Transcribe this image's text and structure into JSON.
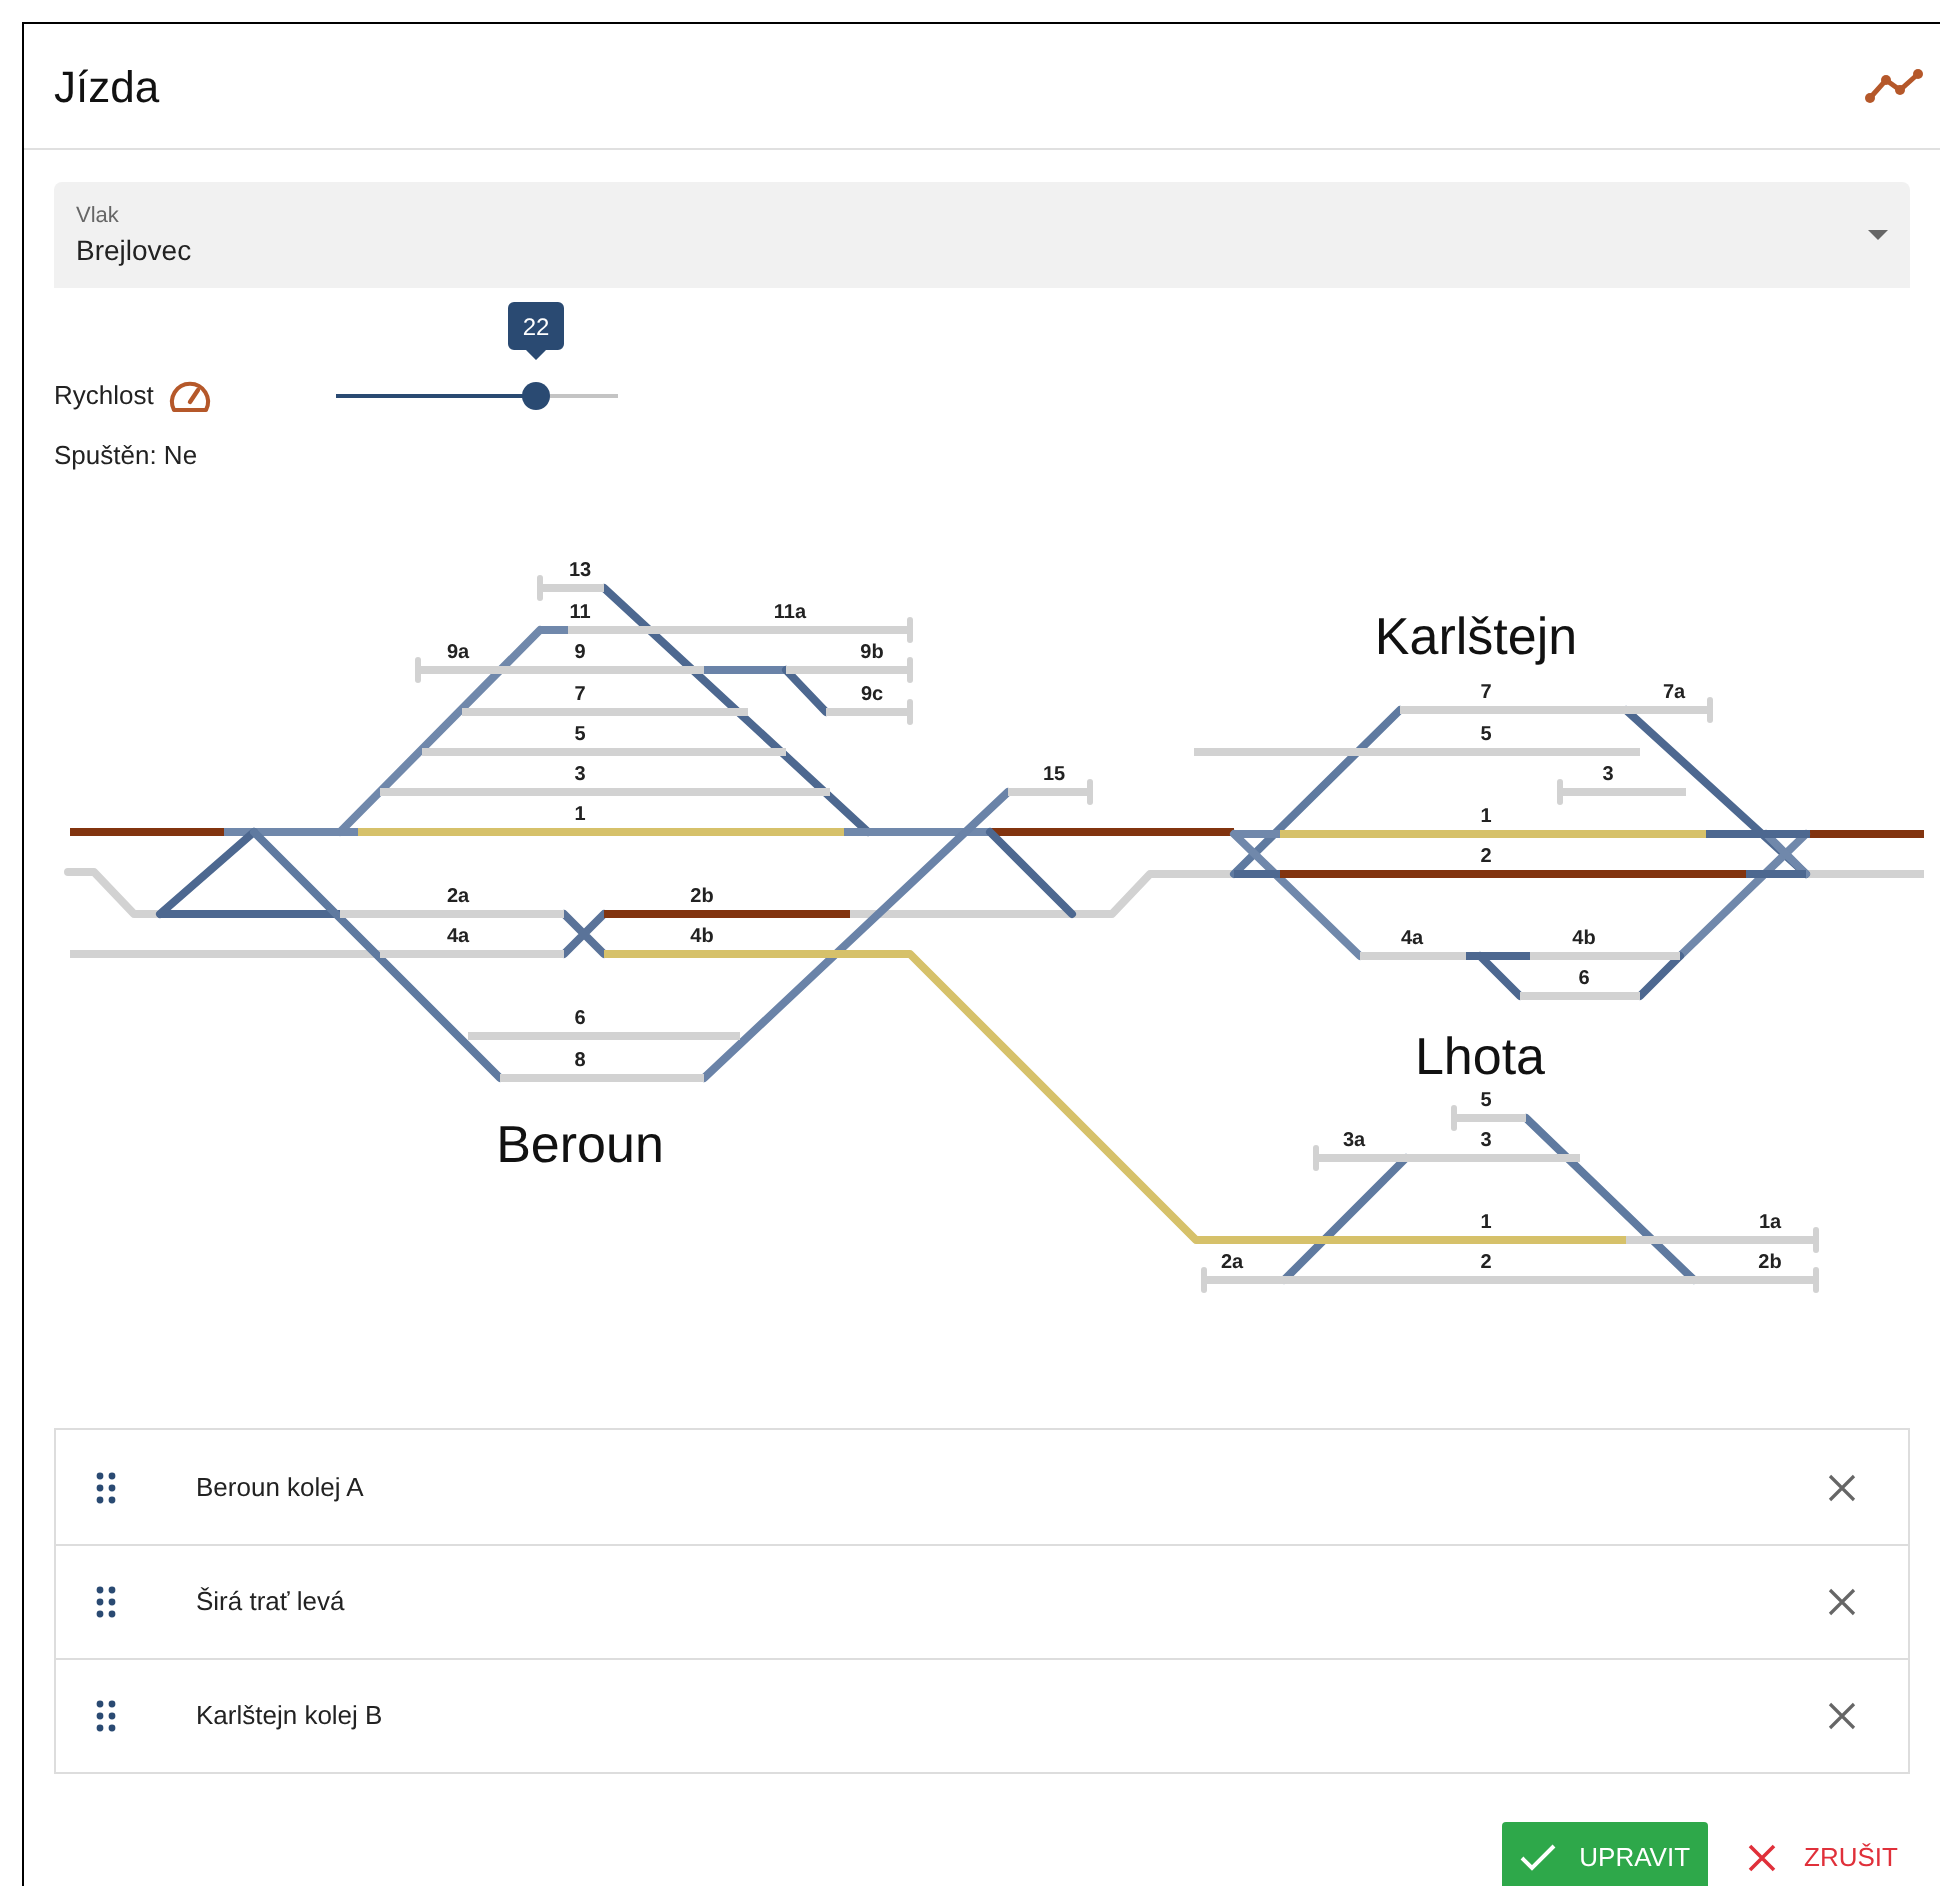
{
  "window": {
    "title": "Jízda"
  },
  "train_select": {
    "label": "Vlak",
    "value": "Brejlovec"
  },
  "speed": {
    "label": "Rychlost",
    "value": "22",
    "level": 0.71
  },
  "running": {
    "text": "Spuštěn: Ne"
  },
  "stations": [
    {
      "name": "Beroun",
      "tracks": [
        {
          "label": "13",
          "occupied": false,
          "in_route": false
        },
        {
          "label": "11",
          "occupied": false,
          "in_route": false
        },
        {
          "label": "11a",
          "occupied": false,
          "in_route": false
        },
        {
          "label": "9a",
          "occupied": false,
          "in_route": false
        },
        {
          "label": "9",
          "occupied": false,
          "in_route": false
        },
        {
          "label": "9b",
          "occupied": false,
          "in_route": false
        },
        {
          "label": "9c",
          "occupied": false,
          "in_route": false
        },
        {
          "label": "7",
          "occupied": false,
          "in_route": false
        },
        {
          "label": "5",
          "occupied": false,
          "in_route": false
        },
        {
          "label": "3",
          "occupied": false,
          "in_route": false
        },
        {
          "label": "1",
          "occupied": false,
          "in_route": true
        },
        {
          "label": "2a",
          "occupied": false,
          "in_route": false
        },
        {
          "label": "2b",
          "occupied": true,
          "in_route": false
        },
        {
          "label": "4a",
          "occupied": false,
          "in_route": false
        },
        {
          "label": "4b",
          "occupied": false,
          "in_route": true
        },
        {
          "label": "6",
          "occupied": false,
          "in_route": false
        },
        {
          "label": "8",
          "occupied": false,
          "in_route": false
        },
        {
          "label": "15",
          "occupied": false,
          "in_route": false
        }
      ]
    },
    {
      "name": "Karlštejn",
      "tracks": [
        {
          "label": "7",
          "occupied": false,
          "in_route": false
        },
        {
          "label": "7a",
          "occupied": false,
          "in_route": false
        },
        {
          "label": "5",
          "occupied": false,
          "in_route": false
        },
        {
          "label": "3",
          "occupied": false,
          "in_route": false
        },
        {
          "label": "1",
          "occupied": false,
          "in_route": true
        },
        {
          "label": "2",
          "occupied": true,
          "in_route": false
        },
        {
          "label": "4a",
          "occupied": false,
          "in_route": false
        },
        {
          "label": "4b",
          "occupied": false,
          "in_route": false
        },
        {
          "label": "6",
          "occupied": false,
          "in_route": false
        }
      ]
    },
    {
      "name": "Lhota",
      "tracks": [
        {
          "label": "5",
          "occupied": false,
          "in_route": false
        },
        {
          "label": "3a",
          "occupied": false,
          "in_route": false
        },
        {
          "label": "3",
          "occupied": false,
          "in_route": false
        },
        {
          "label": "1",
          "occupied": false,
          "in_route": true
        },
        {
          "label": "1a",
          "occupied": false,
          "in_route": false
        },
        {
          "label": "2a",
          "occupied": false,
          "in_route": false
        },
        {
          "label": "2",
          "occupied": false,
          "in_route": false
        },
        {
          "label": "2b",
          "occupied": false,
          "in_route": false
        }
      ]
    }
  ],
  "links": [
    {
      "occupied": true,
      "in_route": false
    },
    {
      "occupied": true,
      "in_route": false
    },
    {
      "occupied": true,
      "in_route": false
    },
    {
      "occupied": false,
      "in_route": false
    },
    {
      "occupied": false,
      "in_route": false
    },
    {
      "occupied": false,
      "in_route": false
    },
    {
      "occupied": false,
      "in_route": false
    },
    {
      "occupied": false,
      "in_route": true
    }
  ],
  "route": [
    {
      "name": "Beroun kolej A"
    },
    {
      "name": "Širá trať levá"
    },
    {
      "name": "Karlštejn kolej B"
    }
  ],
  "buttons": [
    {
      "kind": "confirm",
      "label": "UPRAVIT"
    },
    {
      "kind": "cancel",
      "label": "ZRUŠIT"
    }
  ]
}
